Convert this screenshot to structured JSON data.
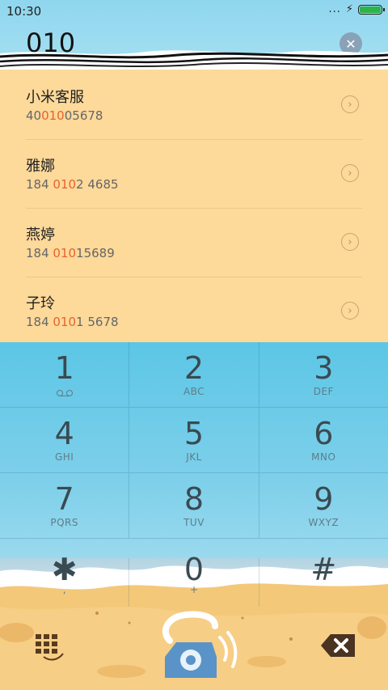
{
  "status_bar": {
    "time": "10:30",
    "dots": "...",
    "charging": "⚡"
  },
  "dialer": {
    "number": "010",
    "clear_symbol": "✕"
  },
  "contacts": [
    {
      "name": "小米客服",
      "phone_pre": "40",
      "phone_match": "010",
      "phone_post": "05678"
    },
    {
      "name": "雅娜",
      "phone_pre": "184 ",
      "phone_match": "010",
      "phone_post": "2 4685"
    },
    {
      "name": "燕婷",
      "phone_pre": "184 ",
      "phone_match": "010",
      "phone_post": "15689"
    },
    {
      "name": "子玲",
      "phone_pre": "184 ",
      "phone_match": "010",
      "phone_post": "1 5678"
    }
  ],
  "chevron": "›",
  "keys": [
    {
      "digit": "1",
      "letters": ""
    },
    {
      "digit": "2",
      "letters": "ABC"
    },
    {
      "digit": "3",
      "letters": "DEF"
    },
    {
      "digit": "4",
      "letters": "GHI"
    },
    {
      "digit": "5",
      "letters": "JKL"
    },
    {
      "digit": "6",
      "letters": "MNO"
    },
    {
      "digit": "7",
      "letters": "PQRS"
    },
    {
      "digit": "8",
      "letters": "TUV"
    },
    {
      "digit": "9",
      "letters": "WXYZ"
    },
    {
      "digit": "✱",
      "letters": ","
    },
    {
      "digit": "0",
      "letters": "+"
    },
    {
      "digit": "#",
      "letters": ""
    }
  ],
  "colors": {
    "highlight": "#e8622c",
    "list_bg": "#fdd99a",
    "sea": "#5cc6e6",
    "sand": "#f4c879",
    "call_button": "#5a93c8"
  },
  "icons": {
    "dialpad": "dialpad-icon",
    "call": "phone-call-icon",
    "backspace": "backspace-icon"
  }
}
